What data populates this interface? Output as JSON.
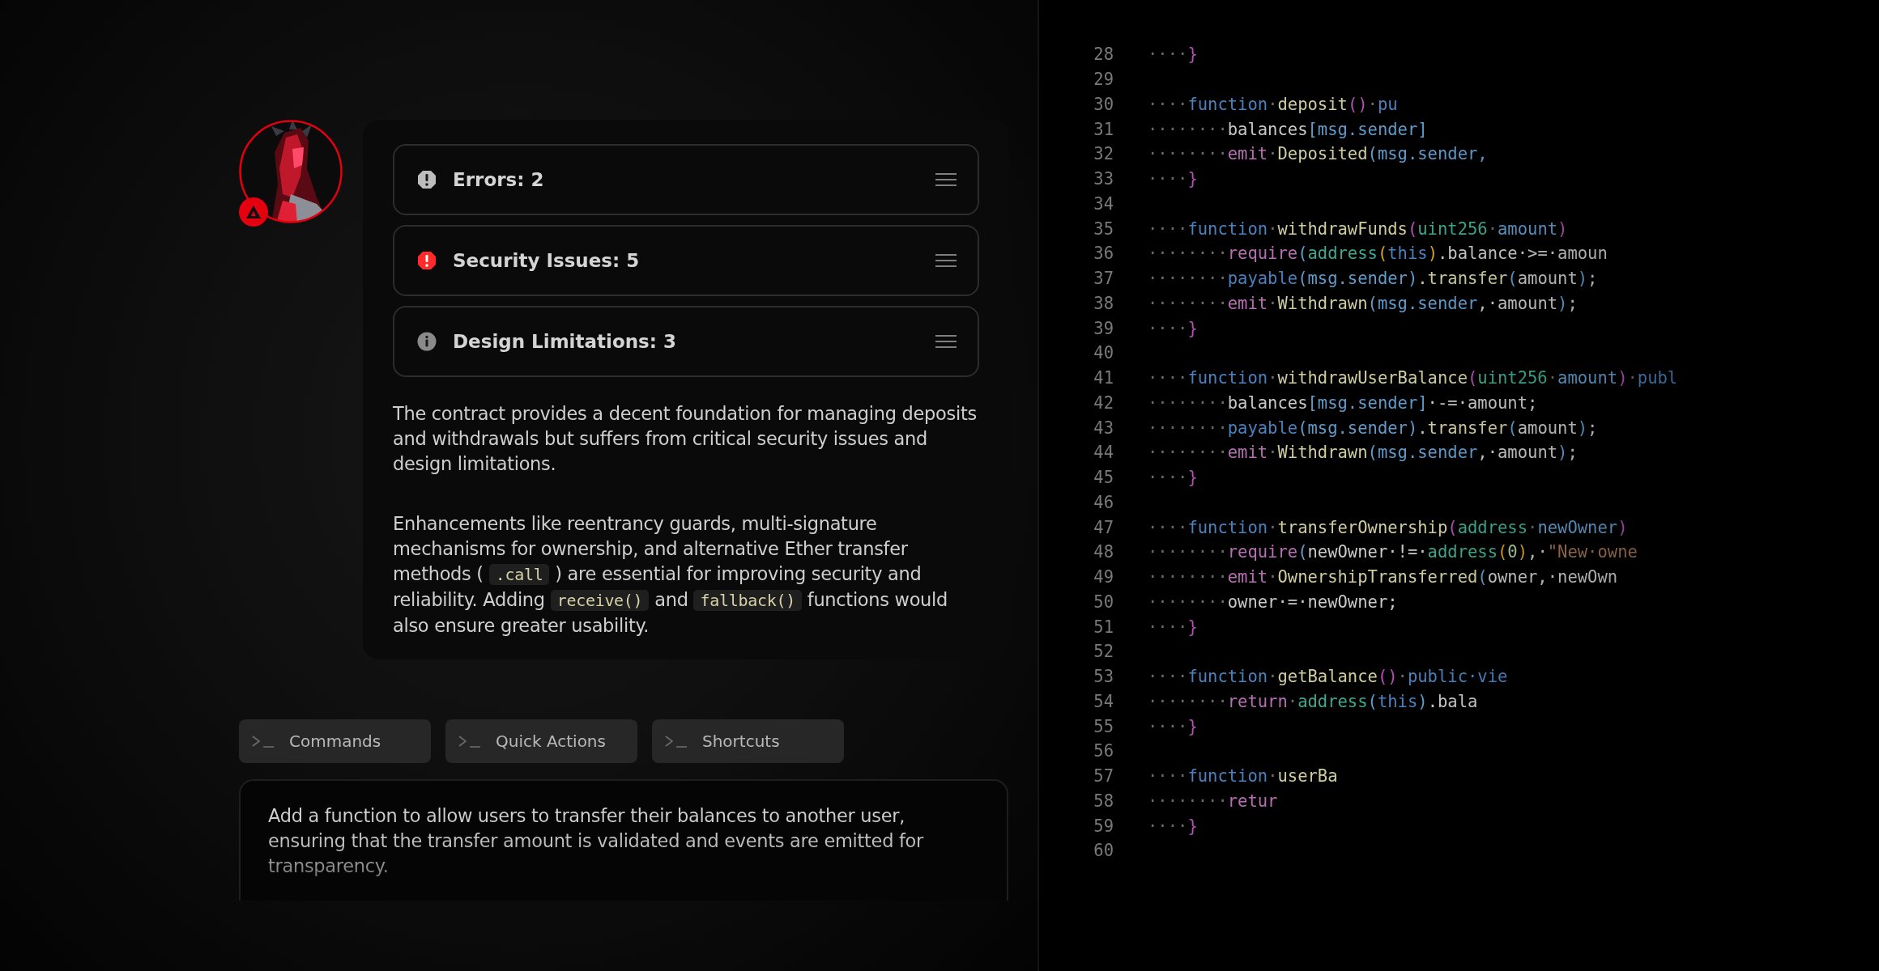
{
  "assistant": {
    "badge": {
      "kind": "warning"
    }
  },
  "report": {
    "findings": [
      {
        "kind": "error",
        "label": "Errors: 2"
      },
      {
        "kind": "security",
        "label": "Security Issues: 5"
      },
      {
        "kind": "info",
        "label": "Design Limitations: 3"
      }
    ],
    "paragraphs": [
      [
        {
          "kind": "text",
          "text": "The contract provides a decent foundation for managing deposits and withdrawals but suffers from critical security issues and design limitations."
        }
      ],
      [
        {
          "kind": "text",
          "text": "Enhancements like reentrancy guards, multi-signature mechanisms for ownership, and alternative Ether transfer methods ( "
        },
        {
          "kind": "code",
          "text": ".call"
        },
        {
          "kind": "text",
          "text": " ) are essential for improving security and reliability. Adding "
        },
        {
          "kind": "code",
          "text": "receive()"
        },
        {
          "kind": "text",
          "text": " and "
        },
        {
          "kind": "code",
          "text": "fallback()"
        },
        {
          "kind": "text",
          "text": " functions would also ensure greater usability."
        }
      ]
    ]
  },
  "quick_buttons": [
    {
      "label": "Commands"
    },
    {
      "label": "Quick Actions"
    },
    {
      "label": "Shortcuts"
    }
  ],
  "prompt": {
    "text": "Add a function to allow users to transfer their balances to another user, ensuring that the transfer amount is validated and events are emitted for transparency."
  },
  "editor": {
    "lines": [
      {
        "number": "28",
        "tokens": [
          {
            "kind": "ws",
            "text": "····"
          },
          {
            "kind": "brace",
            "text": "}"
          }
        ]
      },
      {
        "number": "29"
      },
      {
        "number": "30",
        "tokens": [
          {
            "kind": "ws",
            "text": "····"
          },
          {
            "kind": "keyword",
            "text": "function"
          },
          {
            "kind": "ws",
            "text": "·"
          },
          {
            "kind": "fn",
            "text": "deposit"
          },
          {
            "kind": "paren",
            "text": "()"
          },
          {
            "kind": "ws",
            "text": "·"
          },
          {
            "kind": "keyword",
            "text": "pu"
          }
        ]
      },
      {
        "number": "31",
        "tokens": [
          {
            "kind": "ws",
            "text": "········"
          },
          {
            "kind": "plain",
            "text": "balances"
          },
          {
            "kind": "var",
            "text": "[msg.sender]"
          }
        ]
      },
      {
        "number": "32",
        "tokens": [
          {
            "kind": "ws",
            "text": "········"
          },
          {
            "kind": "control",
            "text": "emit"
          },
          {
            "kind": "ws",
            "text": "·"
          },
          {
            "kind": "fn",
            "text": "Deposited"
          },
          {
            "kind": "var",
            "text": "(msg.sender,"
          }
        ]
      },
      {
        "number": "33",
        "tokens": [
          {
            "kind": "ws",
            "text": "····"
          },
          {
            "kind": "brace",
            "text": "}"
          }
        ]
      },
      {
        "number": "34"
      },
      {
        "number": "35",
        "tokens": [
          {
            "kind": "ws",
            "text": "····"
          },
          {
            "kind": "keyword",
            "text": "function"
          },
          {
            "kind": "ws",
            "text": "·"
          },
          {
            "kind": "fn",
            "text": "withdrawFunds"
          },
          {
            "kind": "paren",
            "text": "("
          },
          {
            "kind": "type",
            "text": "uint256"
          },
          {
            "kind": "ws",
            "text": "·"
          },
          {
            "kind": "var",
            "text": "amount"
          },
          {
            "kind": "paren",
            "text": ")"
          }
        ]
      },
      {
        "number": "36",
        "tokens": [
          {
            "kind": "ws",
            "text": "········"
          },
          {
            "kind": "control",
            "text": "require"
          },
          {
            "kind": "var",
            "text": "("
          },
          {
            "kind": "type",
            "text": "address"
          },
          {
            "kind": "yparen",
            "text": "("
          },
          {
            "kind": "keyword",
            "text": "this"
          },
          {
            "kind": "yparen",
            "text": ")"
          },
          {
            "kind": "plain",
            "text": ".balance·>=·amoun"
          }
        ]
      },
      {
        "number": "37",
        "tokens": [
          {
            "kind": "ws",
            "text": "········"
          },
          {
            "kind": "keyword",
            "text": "payable"
          },
          {
            "kind": "var",
            "text": "(msg.sender)"
          },
          {
            "kind": "fn",
            "text": ".transfer"
          },
          {
            "kind": "var",
            "text": "("
          },
          {
            "kind": "plain",
            "text": "amount"
          },
          {
            "kind": "var",
            "text": ")"
          },
          {
            "kind": "plain",
            "text": ";"
          }
        ]
      },
      {
        "number": "38",
        "tokens": [
          {
            "kind": "ws",
            "text": "········"
          },
          {
            "kind": "control",
            "text": "emit"
          },
          {
            "kind": "ws",
            "text": "·"
          },
          {
            "kind": "fn",
            "text": "Withdrawn"
          },
          {
            "kind": "var",
            "text": "(msg.sender"
          },
          {
            "kind": "plain",
            "text": ",·amount"
          },
          {
            "kind": "var",
            "text": ")"
          },
          {
            "kind": "plain",
            "text": ";"
          }
        ]
      },
      {
        "number": "39",
        "tokens": [
          {
            "kind": "ws",
            "text": "····"
          },
          {
            "kind": "brace",
            "text": "}"
          }
        ]
      },
      {
        "number": "40"
      },
      {
        "number": "41",
        "tokens": [
          {
            "kind": "ws",
            "text": "····"
          },
          {
            "kind": "keyword",
            "text": "function"
          },
          {
            "kind": "ws",
            "text": "·"
          },
          {
            "kind": "fn",
            "text": "withdrawUserBalance"
          },
          {
            "kind": "paren",
            "text": "("
          },
          {
            "kind": "type",
            "text": "uint256"
          },
          {
            "kind": "ws",
            "text": "·"
          },
          {
            "kind": "var",
            "text": "amount"
          },
          {
            "kind": "paren",
            "text": ")"
          },
          {
            "kind": "ws",
            "text": "·"
          },
          {
            "kind": "keyword",
            "text": "publ"
          }
        ]
      },
      {
        "number": "42",
        "tokens": [
          {
            "kind": "ws",
            "text": "········"
          },
          {
            "kind": "plain",
            "text": "balances"
          },
          {
            "kind": "var",
            "text": "[msg.sender]"
          },
          {
            "kind": "plain",
            "text": "·-=·amount;"
          }
        ]
      },
      {
        "number": "43",
        "tokens": [
          {
            "kind": "ws",
            "text": "········"
          },
          {
            "kind": "keyword",
            "text": "payable"
          },
          {
            "kind": "var",
            "text": "(msg.sender)"
          },
          {
            "kind": "fn",
            "text": ".transfer"
          },
          {
            "kind": "var",
            "text": "("
          },
          {
            "kind": "plain",
            "text": "amount"
          },
          {
            "kind": "var",
            "text": ")"
          },
          {
            "kind": "plain",
            "text": ";"
          }
        ]
      },
      {
        "number": "44",
        "tokens": [
          {
            "kind": "ws",
            "text": "········"
          },
          {
            "kind": "control",
            "text": "emit"
          },
          {
            "kind": "ws",
            "text": "·"
          },
          {
            "kind": "fn",
            "text": "Withdrawn"
          },
          {
            "kind": "var",
            "text": "(msg.sender"
          },
          {
            "kind": "plain",
            "text": ",·amount"
          },
          {
            "kind": "var",
            "text": ")"
          },
          {
            "kind": "plain",
            "text": ";"
          }
        ]
      },
      {
        "number": "45",
        "tokens": [
          {
            "kind": "ws",
            "text": "····"
          },
          {
            "kind": "brace",
            "text": "}"
          }
        ]
      },
      {
        "number": "46"
      },
      {
        "number": "47",
        "tokens": [
          {
            "kind": "ws",
            "text": "····"
          },
          {
            "kind": "keyword",
            "text": "function"
          },
          {
            "kind": "ws",
            "text": "·"
          },
          {
            "kind": "fn",
            "text": "transferOwnership"
          },
          {
            "kind": "paren",
            "text": "("
          },
          {
            "kind": "type",
            "text": "address"
          },
          {
            "kind": "ws",
            "text": "·"
          },
          {
            "kind": "var",
            "text": "newOwner"
          },
          {
            "kind": "paren",
            "text": ")"
          }
        ]
      },
      {
        "number": "48",
        "tokens": [
          {
            "kind": "ws",
            "text": "········"
          },
          {
            "kind": "control",
            "text": "require"
          },
          {
            "kind": "var",
            "text": "("
          },
          {
            "kind": "plain",
            "text": "newOwner·!=·"
          },
          {
            "kind": "type",
            "text": "address"
          },
          {
            "kind": "yparen",
            "text": "("
          },
          {
            "kind": "number",
            "text": "0"
          },
          {
            "kind": "yparen",
            "text": ")"
          },
          {
            "kind": "plain",
            "text": ",·"
          },
          {
            "kind": "string",
            "text": "\"New·owne"
          }
        ]
      },
      {
        "number": "49",
        "tokens": [
          {
            "kind": "ws",
            "text": "········"
          },
          {
            "kind": "control",
            "text": "emit"
          },
          {
            "kind": "ws",
            "text": "·"
          },
          {
            "kind": "fn",
            "text": "OwnershipTransferred"
          },
          {
            "kind": "var",
            "text": "("
          },
          {
            "kind": "plain",
            "text": "owner,·newOwn"
          }
        ]
      },
      {
        "number": "50",
        "tokens": [
          {
            "kind": "ws",
            "text": "········"
          },
          {
            "kind": "plain",
            "text": "owner·=·newOwner;"
          }
        ]
      },
      {
        "number": "51",
        "tokens": [
          {
            "kind": "ws",
            "text": "····"
          },
          {
            "kind": "brace",
            "text": "}"
          }
        ]
      },
      {
        "number": "52"
      },
      {
        "number": "53",
        "tokens": [
          {
            "kind": "ws",
            "text": "····"
          },
          {
            "kind": "keyword",
            "text": "function"
          },
          {
            "kind": "ws",
            "text": "·"
          },
          {
            "kind": "fn",
            "text": "getBalance"
          },
          {
            "kind": "paren",
            "text": "()"
          },
          {
            "kind": "ws",
            "text": "·"
          },
          {
            "kind": "keyword",
            "text": "public·vie"
          }
        ]
      },
      {
        "number": "54",
        "tokens": [
          {
            "kind": "ws",
            "text": "········"
          },
          {
            "kind": "control",
            "text": "return"
          },
          {
            "kind": "ws",
            "text": "·"
          },
          {
            "kind": "type",
            "text": "address"
          },
          {
            "kind": "var",
            "text": "("
          },
          {
            "kind": "keyword",
            "text": "this"
          },
          {
            "kind": "var",
            "text": ")"
          },
          {
            "kind": "plain",
            "text": ".bala"
          }
        ]
      },
      {
        "number": "55",
        "tokens": [
          {
            "kind": "ws",
            "text": "····"
          },
          {
            "kind": "brace",
            "text": "}"
          }
        ]
      },
      {
        "number": "56"
      },
      {
        "number": "57",
        "tokens": [
          {
            "kind": "ws",
            "text": "····"
          },
          {
            "kind": "keyword",
            "text": "function"
          },
          {
            "kind": "ws",
            "text": "·"
          },
          {
            "kind": "fn",
            "text": "userBa"
          }
        ]
      },
      {
        "number": "58",
        "tokens": [
          {
            "kind": "ws",
            "text": "········"
          },
          {
            "kind": "control",
            "text": "retur"
          }
        ]
      },
      {
        "number": "59",
        "tokens": [
          {
            "kind": "ws",
            "text": "····"
          },
          {
            "kind": "brace",
            "text": "}"
          }
        ]
      },
      {
        "number": "60"
      }
    ]
  }
}
